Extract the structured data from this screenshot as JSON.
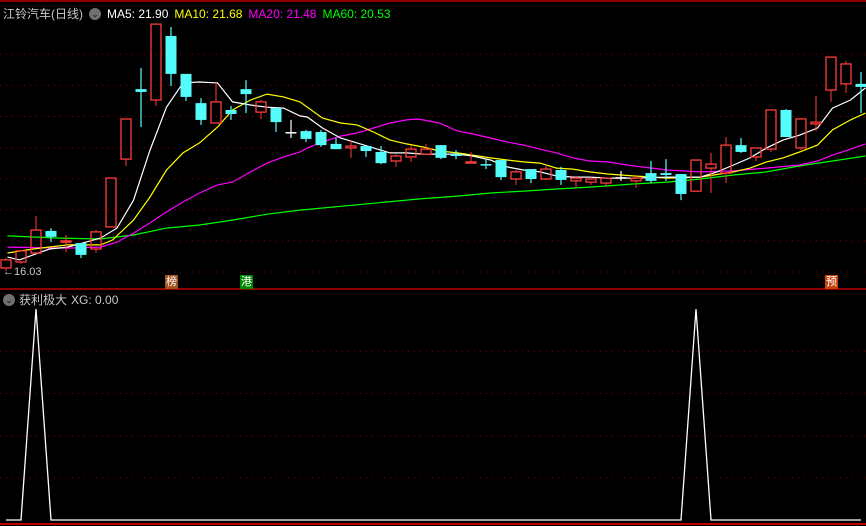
{
  "header": {
    "title": "江铃汽车(日线)",
    "ma5": "MA5: 21.90",
    "ma10": "MA10: 21.68",
    "ma20": "MA20: 21.48",
    "ma60": "MA60: 20.53"
  },
  "indicator": {
    "name": "获利极大",
    "value_label": "XG: 0.00"
  },
  "low_label": "←16.03",
  "colors": {
    "up": "#ff3c3c",
    "down": "#54fcfc",
    "doji": "#ffffff",
    "ma5": "#ffffff",
    "ma10": "#ffff00",
    "ma20": "#ff00ff",
    "ma60": "#00ff00",
    "grid": "#8a0000",
    "border": "#c00000"
  },
  "markers": [
    {
      "index": 11,
      "text": "榜",
      "color": "#a0521a"
    },
    {
      "index": 16,
      "text": "港",
      "color": "#008a00"
    },
    {
      "index": 55,
      "text": "预",
      "color": "#c8440e"
    }
  ],
  "chart_data": [
    {
      "type": "candlestick",
      "title": "江铃汽车(日线)",
      "ylim": [
        16,
        24
      ],
      "grid": true,
      "candles_ohlc": [
        [
          16.13,
          16.45,
          16.03,
          16.39
        ],
        [
          16.32,
          16.71,
          16.26,
          16.68
        ],
        [
          16.61,
          17.8,
          16.61,
          17.35
        ],
        [
          17.32,
          17.41,
          16.96,
          17.13
        ],
        [
          16.96,
          17.19,
          16.64,
          17.0
        ],
        [
          16.93,
          16.93,
          16.45,
          16.55
        ],
        [
          16.74,
          17.35,
          16.61,
          17.29
        ],
        [
          17.45,
          19.02,
          17.45,
          19.02
        ],
        [
          19.63,
          20.92,
          19.41,
          20.92
        ],
        [
          21.88,
          22.56,
          20.66,
          21.79
        ],
        [
          21.53,
          23.97,
          21.34,
          23.97
        ],
        [
          23.59,
          23.88,
          21.98,
          22.37
        ],
        [
          22.37,
          22.37,
          21.5,
          21.63
        ],
        [
          21.43,
          21.59,
          20.73,
          20.89
        ],
        [
          20.79,
          22.08,
          20.79,
          21.47
        ],
        [
          21.21,
          21.34,
          20.89,
          21.08
        ],
        [
          21.88,
          22.17,
          21.11,
          21.72
        ],
        [
          21.14,
          21.53,
          20.92,
          21.47
        ],
        [
          21.27,
          21.27,
          20.5,
          20.82
        ],
        [
          20.5,
          20.89,
          20.31,
          20.5
        ],
        [
          20.53,
          20.57,
          20.18,
          20.28
        ],
        [
          20.5,
          20.57,
          20.02,
          20.08
        ],
        [
          20.12,
          20.31,
          19.95,
          19.95
        ],
        [
          19.99,
          20.24,
          19.67,
          20.05
        ],
        [
          20.05,
          20.05,
          19.7,
          19.89
        ],
        [
          19.86,
          20.05,
          19.47,
          19.5
        ],
        [
          19.57,
          19.79,
          19.38,
          19.73
        ],
        [
          19.7,
          20.05,
          19.54,
          19.95
        ],
        [
          19.79,
          20.12,
          19.79,
          19.95
        ],
        [
          20.08,
          20.08,
          19.63,
          19.67
        ],
        [
          19.79,
          19.92,
          19.63,
          19.73
        ],
        [
          19.5,
          19.86,
          19.5,
          19.54
        ],
        [
          19.47,
          19.63,
          19.31,
          19.44
        ],
        [
          19.6,
          19.6,
          18.96,
          19.05
        ],
        [
          18.99,
          19.28,
          18.8,
          19.22
        ],
        [
          19.31,
          19.31,
          18.86,
          18.99
        ],
        [
          18.99,
          19.44,
          18.96,
          19.31
        ],
        [
          19.28,
          19.38,
          18.8,
          18.96
        ],
        [
          18.93,
          19.09,
          18.7,
          19.02
        ],
        [
          18.89,
          19.05,
          18.8,
          18.99
        ],
        [
          18.86,
          19.02,
          18.77,
          19.02
        ],
        [
          19.05,
          19.25,
          18.93,
          19.05
        ],
        [
          18.93,
          19.09,
          18.7,
          19.02
        ],
        [
          19.18,
          19.57,
          18.86,
          18.93
        ],
        [
          19.18,
          19.63,
          18.93,
          19.12
        ],
        [
          19.15,
          19.15,
          18.31,
          18.51
        ],
        [
          18.6,
          19.6,
          18.6,
          19.6
        ],
        [
          19.34,
          19.83,
          18.54,
          19.47
        ],
        [
          19.18,
          20.34,
          18.86,
          20.08
        ],
        [
          20.08,
          20.31,
          19.83,
          19.86
        ],
        [
          19.7,
          19.99,
          19.57,
          19.99
        ],
        [
          19.95,
          21.21,
          19.86,
          21.21
        ],
        [
          21.21,
          21.24,
          20.34,
          20.34
        ],
        [
          19.99,
          20.95,
          19.92,
          20.92
        ],
        [
          20.76,
          21.66,
          20.53,
          20.82
        ],
        [
          21.85,
          22.91,
          21.47,
          22.91
        ],
        [
          22.05,
          22.79,
          21.76,
          22.69
        ],
        [
          22.05,
          22.43,
          21.11,
          21.95
        ]
      ],
      "series": [
        {
          "name": "MA5",
          "points": [
            [
              0.1,
              16.48
            ],
            [
              0.9,
              16.39
            ],
            [
              1.8,
              16.55
            ],
            [
              2.9,
              16.74
            ],
            [
              4.1,
              16.8
            ],
            [
              5.1,
              16.93
            ],
            [
              6.3,
              17.09
            ],
            [
              7.4,
              17.41
            ],
            [
              8.5,
              18.31
            ],
            [
              9.6,
              19.92
            ],
            [
              10.7,
              21.3
            ],
            [
              11.8,
              22.08
            ],
            [
              12.9,
              22.11
            ],
            [
              14.1,
              22.08
            ],
            [
              15.1,
              21.47
            ],
            [
              16.3,
              21.37
            ],
            [
              17.4,
              21.3
            ],
            [
              18.5,
              21.27
            ],
            [
              19.6,
              21.02
            ],
            [
              20.1,
              20.98
            ],
            [
              21.1,
              20.63
            ],
            [
              22.3,
              20.31
            ],
            [
              23.4,
              20.15
            ],
            [
              24.5,
              19.99
            ],
            [
              25.6,
              19.83
            ],
            [
              26.7,
              19.83
            ],
            [
              27.8,
              19.79
            ],
            [
              28.9,
              19.79
            ],
            [
              30.1,
              19.79
            ],
            [
              31.1,
              19.73
            ],
            [
              32.3,
              19.6
            ],
            [
              33.4,
              19.38
            ],
            [
              34.5,
              19.28
            ],
            [
              35.6,
              19.22
            ],
            [
              36.7,
              19.09
            ],
            [
              37.8,
              19.05
            ],
            [
              38.9,
              19.05
            ],
            [
              40.1,
              19.02
            ],
            [
              41.8,
              19.02
            ],
            [
              44.1,
              19.05
            ],
            [
              46.3,
              19.05
            ],
            [
              47.4,
              19.22
            ],
            [
              48.5,
              19.44
            ],
            [
              49.6,
              19.67
            ],
            [
              50.7,
              19.99
            ],
            [
              51.8,
              20.24
            ],
            [
              52.9,
              20.4
            ],
            [
              54.1,
              20.63
            ],
            [
              55.1,
              21.27
            ],
            [
              56.3,
              21.53
            ],
            [
              57.3,
              21.92
            ]
          ]
        },
        {
          "name": "MA10",
          "points": [
            [
              0.1,
              16.61
            ],
            [
              1.8,
              16.74
            ],
            [
              4.1,
              16.87
            ],
            [
              6.3,
              16.87
            ],
            [
              7.1,
              17.03
            ],
            [
              8.5,
              17.67
            ],
            [
              9.6,
              18.41
            ],
            [
              10.7,
              19.28
            ],
            [
              11.8,
              19.83
            ],
            [
              12.9,
              20.15
            ],
            [
              14.1,
              20.66
            ],
            [
              15.1,
              21.21
            ],
            [
              16.3,
              21.53
            ],
            [
              17.4,
              21.72
            ],
            [
              18.5,
              21.63
            ],
            [
              19.6,
              21.47
            ],
            [
              21.1,
              20.95
            ],
            [
              22.3,
              20.79
            ],
            [
              23.4,
              20.73
            ],
            [
              24.5,
              20.5
            ],
            [
              25.6,
              20.24
            ],
            [
              26.7,
              20.12
            ],
            [
              27.8,
              20.02
            ],
            [
              28.9,
              19.89
            ],
            [
              30.1,
              19.83
            ],
            [
              31.1,
              19.76
            ],
            [
              32.3,
              19.67
            ],
            [
              33.4,
              19.6
            ],
            [
              34.5,
              19.54
            ],
            [
              35.6,
              19.5
            ],
            [
              36.7,
              19.34
            ],
            [
              37.8,
              19.31
            ],
            [
              38.9,
              19.22
            ],
            [
              40.1,
              19.15
            ],
            [
              41.8,
              19.09
            ],
            [
              44.1,
              19.02
            ],
            [
              46.3,
              19.05
            ],
            [
              48.5,
              19.22
            ],
            [
              49.6,
              19.34
            ],
            [
              50.7,
              19.54
            ],
            [
              51.8,
              19.67
            ],
            [
              52.9,
              19.86
            ],
            [
              54.1,
              20.08
            ],
            [
              55.1,
              20.57
            ],
            [
              56.3,
              20.89
            ],
            [
              57.3,
              21.11
            ]
          ]
        },
        {
          "name": "MA20",
          "points": [
            [
              0.1,
              16.8
            ],
            [
              4.1,
              16.77
            ],
            [
              6.3,
              16.8
            ],
            [
              7.4,
              16.96
            ],
            [
              8.5,
              17.25
            ],
            [
              9.6,
              17.58
            ],
            [
              10.7,
              17.93
            ],
            [
              11.8,
              18.25
            ],
            [
              12.9,
              18.54
            ],
            [
              14.1,
              18.8
            ],
            [
              15.1,
              18.89
            ],
            [
              16.3,
              19.22
            ],
            [
              17.4,
              19.5
            ],
            [
              18.5,
              19.7
            ],
            [
              19.6,
              19.86
            ],
            [
              20.1,
              19.99
            ],
            [
              21.1,
              20.18
            ],
            [
              22.3,
              20.37
            ],
            [
              23.4,
              20.47
            ],
            [
              24.5,
              20.63
            ],
            [
              25.6,
              20.79
            ],
            [
              26.7,
              20.89
            ],
            [
              27.4,
              20.92
            ],
            [
              27.8,
              20.89
            ],
            [
              28.9,
              20.79
            ],
            [
              30.1,
              20.53
            ],
            [
              31.1,
              20.44
            ],
            [
              32.3,
              20.31
            ],
            [
              33.4,
              20.18
            ],
            [
              34.5,
              20.08
            ],
            [
              35.6,
              19.95
            ],
            [
              36.7,
              19.83
            ],
            [
              37.8,
              19.67
            ],
            [
              38.9,
              19.57
            ],
            [
              40.1,
              19.54
            ],
            [
              41.8,
              19.41
            ],
            [
              44.1,
              19.28
            ],
            [
              46.3,
              19.22
            ],
            [
              48.5,
              19.25
            ],
            [
              50.7,
              19.34
            ],
            [
              52.9,
              19.44
            ],
            [
              54.1,
              19.57
            ],
            [
              55.1,
              19.76
            ],
            [
              56.3,
              19.95
            ],
            [
              57.3,
              20.12
            ]
          ]
        },
        {
          "name": "MA60",
          "points": [
            [
              0.1,
              17.16
            ],
            [
              1.6,
              17.13
            ],
            [
              3.6,
              17.09
            ],
            [
              6.3,
              17.06
            ],
            [
              8.5,
              17.19
            ],
            [
              10.7,
              17.41
            ],
            [
              12.9,
              17.51
            ],
            [
              15.1,
              17.67
            ],
            [
              17.4,
              17.86
            ],
            [
              19.6,
              17.99
            ],
            [
              27.6,
              18.35
            ],
            [
              30.1,
              18.44
            ],
            [
              32.3,
              18.54
            ],
            [
              34.5,
              18.6
            ],
            [
              36.7,
              18.67
            ],
            [
              38.9,
              18.73
            ],
            [
              40.1,
              18.77
            ],
            [
              41.8,
              18.83
            ],
            [
              44.1,
              18.89
            ],
            [
              46.3,
              18.99
            ],
            [
              48.5,
              19.12
            ],
            [
              50.7,
              19.22
            ],
            [
              52.9,
              19.41
            ],
            [
              55.1,
              19.57
            ],
            [
              57.3,
              19.73
            ]
          ]
        }
      ]
    },
    {
      "type": "line",
      "title": "获利极大",
      "ylim": [
        0,
        1
      ],
      "series": [
        {
          "name": "XG",
          "signal_indices": [
            2,
            46
          ],
          "signal_value": 1
        }
      ]
    }
  ]
}
